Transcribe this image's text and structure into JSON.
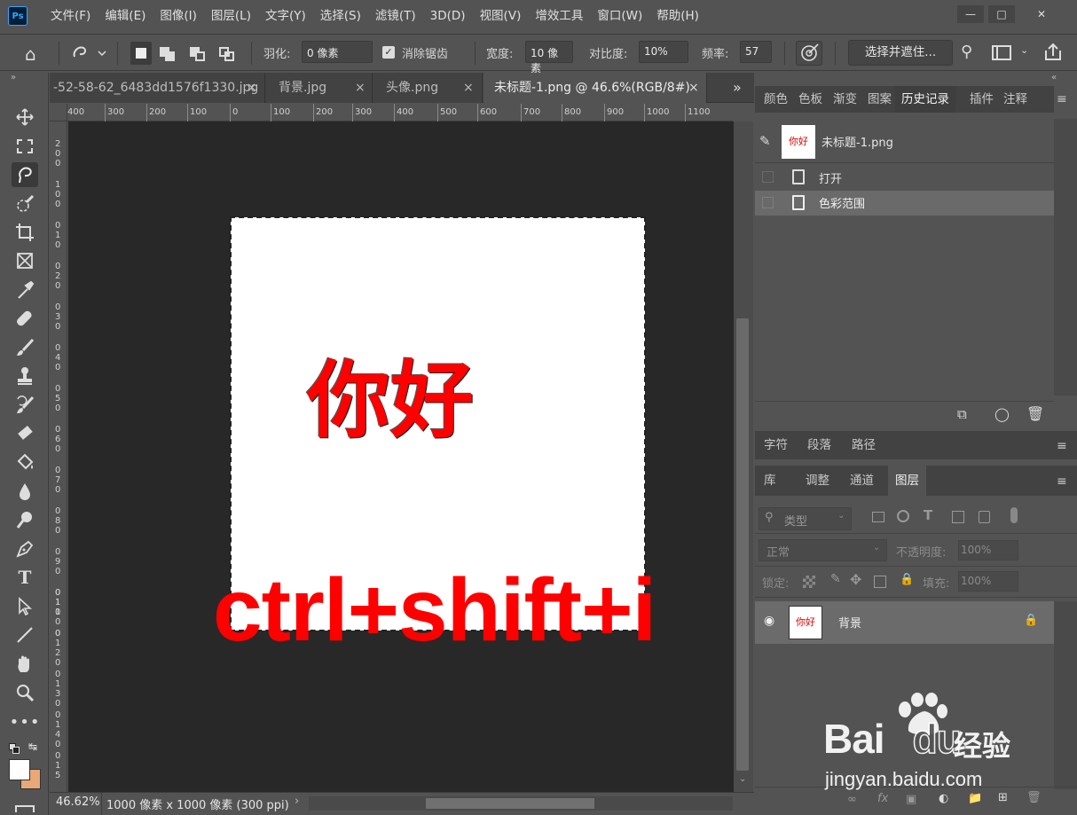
{
  "app_icon": "Ps",
  "menu": [
    "文件(F)",
    "编辑(E)",
    "图像(I)",
    "图层(L)",
    "文字(Y)",
    "选择(S)",
    "滤镜(T)",
    "3D(D)",
    "视图(V)",
    "增效工具",
    "窗口(W)",
    "帮助(H)"
  ],
  "window_controls": [
    "minimize-icon",
    "restore-icon",
    "close-icon"
  ],
  "options": {
    "feather_label": "羽化:",
    "feather_value": "0 像素",
    "antialias_label": "消除锯齿",
    "width_label": "宽度:",
    "width_value": "10 像素",
    "contrast_label": "对比度:",
    "contrast_value": "10%",
    "frequency_label": "频率:",
    "frequency_value": "57",
    "select_mask_button": "选择并遮住..."
  },
  "tabs": [
    {
      "label": "-52-58-62_6483dd1576f1330.jpg",
      "close": "×"
    },
    {
      "label": "背景.jpg",
      "close": "×"
    },
    {
      "label": "头像.png",
      "close": "×"
    },
    {
      "label": "未标题-1.png @ 46.6%(RGB/8#)",
      "close": "×"
    }
  ],
  "tabs_overflow": "»",
  "ruler_h": [
    "400",
    "300",
    "200",
    "100",
    "0",
    "100",
    "200",
    "300",
    "400",
    "500",
    "600",
    "700",
    "800",
    "900",
    "1000",
    "1100"
  ],
  "ruler_v": [
    "2",
    "0",
    "0",
    "1",
    "0",
    "0",
    "0",
    "1",
    "0",
    "0",
    "2",
    "0",
    "0",
    "3",
    "0",
    "0",
    "4",
    "0",
    "0",
    "5",
    "0",
    "0",
    "6",
    "0",
    "0",
    "7",
    "0",
    "0",
    "8",
    "0",
    "0",
    "9",
    "0",
    "0",
    "1",
    "0",
    "0",
    "0",
    "1",
    "1",
    "0",
    "0",
    "1",
    "2",
    "0",
    "0",
    "1",
    "3",
    "0",
    "0",
    "1",
    "4",
    "0",
    "0",
    "1",
    "5",
    "0",
    "0"
  ],
  "document": {
    "text": "你好",
    "text_color": "#ff0000"
  },
  "overlay_text": "ctrl+shift+i",
  "status": {
    "zoom": "46.62%",
    "info": "1000 像素 x 1000 像素 (300 ppi)",
    "arrow": "›"
  },
  "panel_top": {
    "tabs": [
      "颜色",
      "色板",
      "渐变",
      "图案",
      "历史记录",
      "插件",
      "注释"
    ],
    "active": "历史记录",
    "snapshot_name": "未标题-1.png",
    "snapshot_thumb_text": "你好",
    "history": [
      "打开",
      "色彩范围"
    ]
  },
  "panel_mid": {
    "tabs": [
      "字符",
      "段落",
      "路径"
    ]
  },
  "panel_layers": {
    "tabs": [
      "库",
      "调整",
      "通道",
      "图层"
    ],
    "active": "图层",
    "filter_label": "类型",
    "blend_mode": "正常",
    "opacity_label": "不透明度:",
    "opacity_value": "100%",
    "lock_label": "锁定:",
    "fill_label": "填充:",
    "fill_value": "100%",
    "layer_name": "背景",
    "layer_thumb_text": "你好"
  },
  "watermark": {
    "brand": "Bai",
    "brand2": "du",
    "cn": "经验",
    "url": "jingyan.baidu.com"
  },
  "colors": {
    "bg": "#535353",
    "canvas": "#282828",
    "accent_red": "#ff0000"
  }
}
